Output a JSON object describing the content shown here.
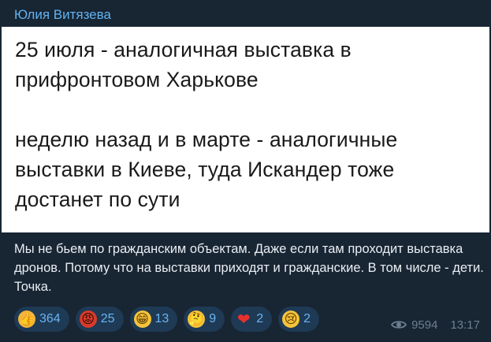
{
  "message": {
    "author": "Юлия Витязева",
    "image_text": {
      "paragraph_1": "25 июля - аналогичная выставка в прифронтовом Харькове",
      "paragraph_2": "неделю назад и в марте - аналогичные выставки в Киеве, туда Искандер тоже достанет по сути"
    },
    "caption": "Мы не бьем по гражданским объектам. Даже если там проходит выставка дронов. Потому что на выставки приходят и гражданские. В том числе - дети. Точка.",
    "reactions": [
      {
        "icon": "thumbs-up-icon",
        "glyph": "👍",
        "count": "364"
      },
      {
        "icon": "angry-face-icon",
        "glyph": "😡",
        "count": "25"
      },
      {
        "icon": "grinning-face-icon",
        "glyph": "😁",
        "count": "13"
      },
      {
        "icon": "thinking-face-icon",
        "glyph": "🤔",
        "count": "9"
      },
      {
        "icon": "red-heart-icon",
        "glyph": "❤",
        "count": "2"
      },
      {
        "icon": "crying-face-icon",
        "glyph": "😢",
        "count": "2"
      }
    ],
    "views": "9594",
    "time": "13:17"
  },
  "colors": {
    "background": "#17212b",
    "author": "#61b3f2",
    "reaction_bg": "#1e3a55",
    "reaction_count": "#6ab3f3",
    "meta": "#6d7f8f"
  }
}
